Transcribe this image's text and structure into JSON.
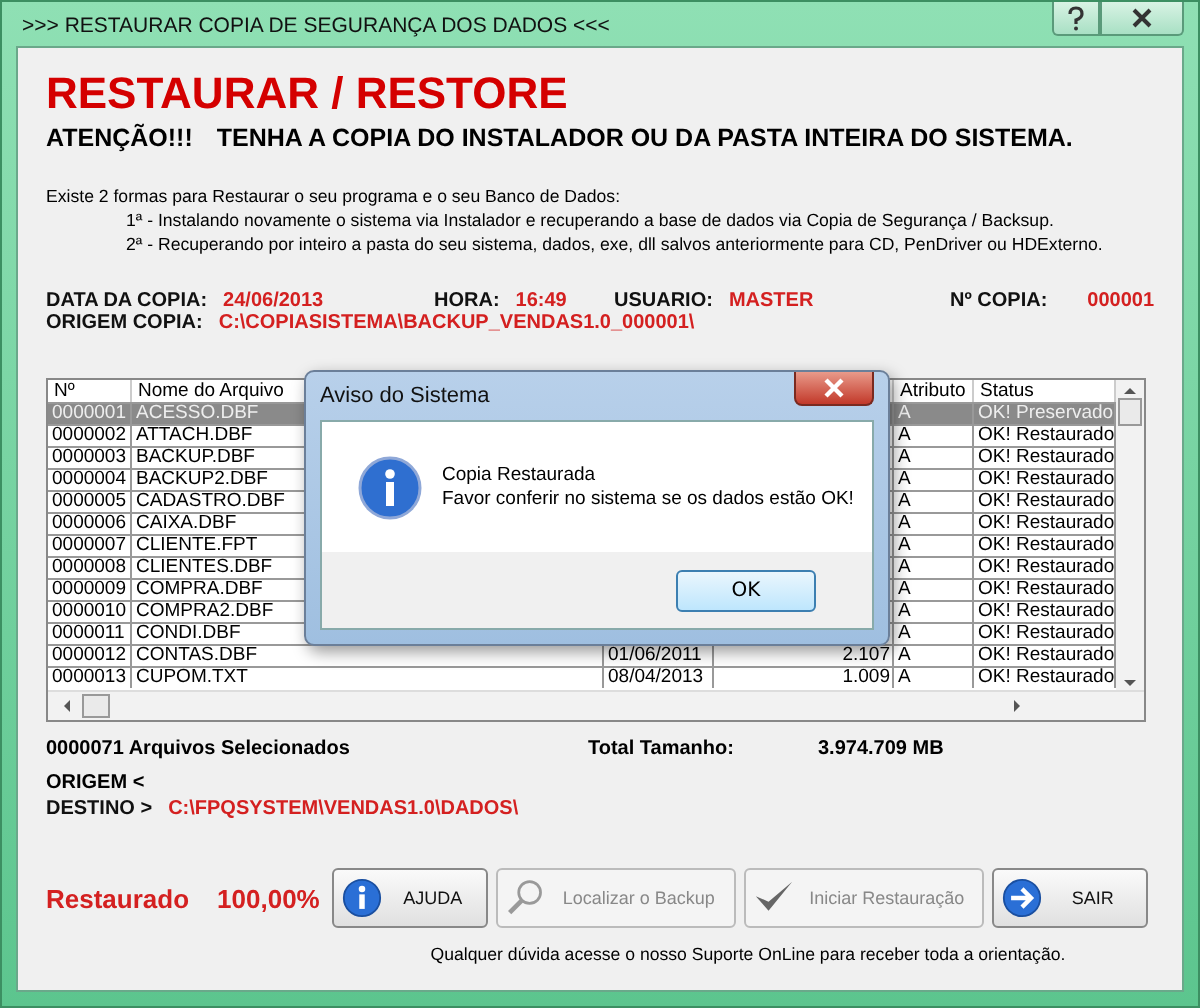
{
  "window": {
    "title": ">>> RESTAURAR COPIA DE SEGURANÇA DOS DADOS <<<"
  },
  "heading": "RESTAURAR / RESTORE",
  "warning": {
    "label": "ATENÇÃO!!!",
    "text": "TENHA  A COPIA DO INSTALADOR OU DA PASTA INTEIRA DO SISTEMA."
  },
  "intro": "Existe 2 formas para Restaurar o seu programa e o seu Banco de Dados:",
  "options": [
    "1ª - Instalando novamente o sistema via Instalador e recuperando a base de dados via Copia de Segurança / Backsup.",
    "2ª - Recuperando por inteiro a pasta do seu sistema, dados, exe, dll salvos anteriormente para CD, PenDriver ou HDExterno."
  ],
  "copy_info": [
    {
      "label": "DATA DA COPIA:",
      "value": "24/06/2013"
    },
    {
      "label": "HORA:",
      "value": "16:49"
    },
    {
      "label": "USUARIO:",
      "value": "MASTER"
    },
    {
      "label": "Nº COPIA:",
      "value": "000001"
    }
  ],
  "origin": {
    "label": "ORIGEM COPIA:",
    "value": "C:\\COPIASISTEMA\\BACKUP_VENDAS1.0_000001\\"
  },
  "table": {
    "columns": [
      "Nº",
      "Nome do Arquivo",
      "Atributo",
      "Status"
    ],
    "rows": [
      {
        "number": "0000001",
        "name": "ACESSO.DBF",
        "attribute": "A",
        "status": "OK! Preservado",
        "selected": true
      },
      {
        "number": "0000002",
        "name": "ATTACH.DBF",
        "attribute": "A",
        "status": "OK! Restaurado",
        "selected": false
      },
      {
        "number": "0000003",
        "name": "BACKUP.DBF",
        "attribute": "A",
        "status": "OK! Restaurado",
        "selected": false
      },
      {
        "number": "0000004",
        "name": "BACKUP2.DBF",
        "attribute": "A",
        "status": "OK! Restaurado",
        "selected": false
      },
      {
        "number": "0000005",
        "name": "CADASTRO.DBF",
        "attribute": "A",
        "status": "OK! Restaurado",
        "selected": false
      },
      {
        "number": "0000006",
        "name": "CAIXA.DBF",
        "attribute": "A",
        "status": "OK! Restaurado",
        "selected": false
      },
      {
        "number": "0000007",
        "name": "CLIENTE.FPT",
        "attribute": "A",
        "status": "OK! Restaurado",
        "selected": false
      },
      {
        "number": "0000008",
        "name": "CLIENTES.DBF",
        "attribute": "A",
        "status": "OK! Restaurado",
        "selected": false
      },
      {
        "number": "0000009",
        "name": "COMPRA.DBF",
        "attribute": "A",
        "status": "OK! Restaurado",
        "selected": false
      },
      {
        "number": "0000010",
        "name": "COMPRA2.DBF",
        "attribute": "A",
        "status": "OK! Restaurado",
        "selected": false
      },
      {
        "number": "0000011",
        "name": "CONDI.DBF",
        "attribute": "A",
        "status": "OK! Restaurado",
        "selected": false
      },
      {
        "number": "0000012",
        "name": "CONTAS.DBF",
        "column_3": "01/06/2011",
        "column_4": "2.107",
        "attribute": "A",
        "status": "OK! Restaurado",
        "selected": false
      },
      {
        "number": "0000013",
        "name": "CUPOM.TXT",
        "column_3": "08/04/2013",
        "column_4": "1.009",
        "attribute": "A",
        "status": "OK! Restaurado",
        "selected": false
      }
    ]
  },
  "summary": {
    "count": "0000071 Arquivos  Selecionados",
    "total_label": "Total Tamanho:",
    "total_value": "3.974.709 MB"
  },
  "source_label": "ORIGEM  <",
  "destination": {
    "label": "DESTINO >",
    "value": "C:\\FPQSYSTEM\\VENDAS1.0\\DADOS\\"
  },
  "progress": {
    "label": "Restaurado",
    "value": "100,00%"
  },
  "buttons": [
    {
      "label": "AJUDA",
      "kind": "info",
      "disabled": false
    },
    {
      "label": "Localizar o Backup",
      "kind": "search",
      "disabled": true
    },
    {
      "label": "Iniciar Restauração",
      "kind": "check",
      "disabled": true
    },
    {
      "label": "SAIR",
      "kind": "arrow",
      "disabled": false
    }
  ],
  "footer": "Qualquer dúvida acesse o nosso Suporte OnLine para receber toda a orientação.",
  "dialog": {
    "title": "Aviso do Sistema",
    "lines": [
      "Copia Restaurada",
      "Favor conferir no sistema se os dados estão OK!"
    ],
    "button": "OK"
  }
}
